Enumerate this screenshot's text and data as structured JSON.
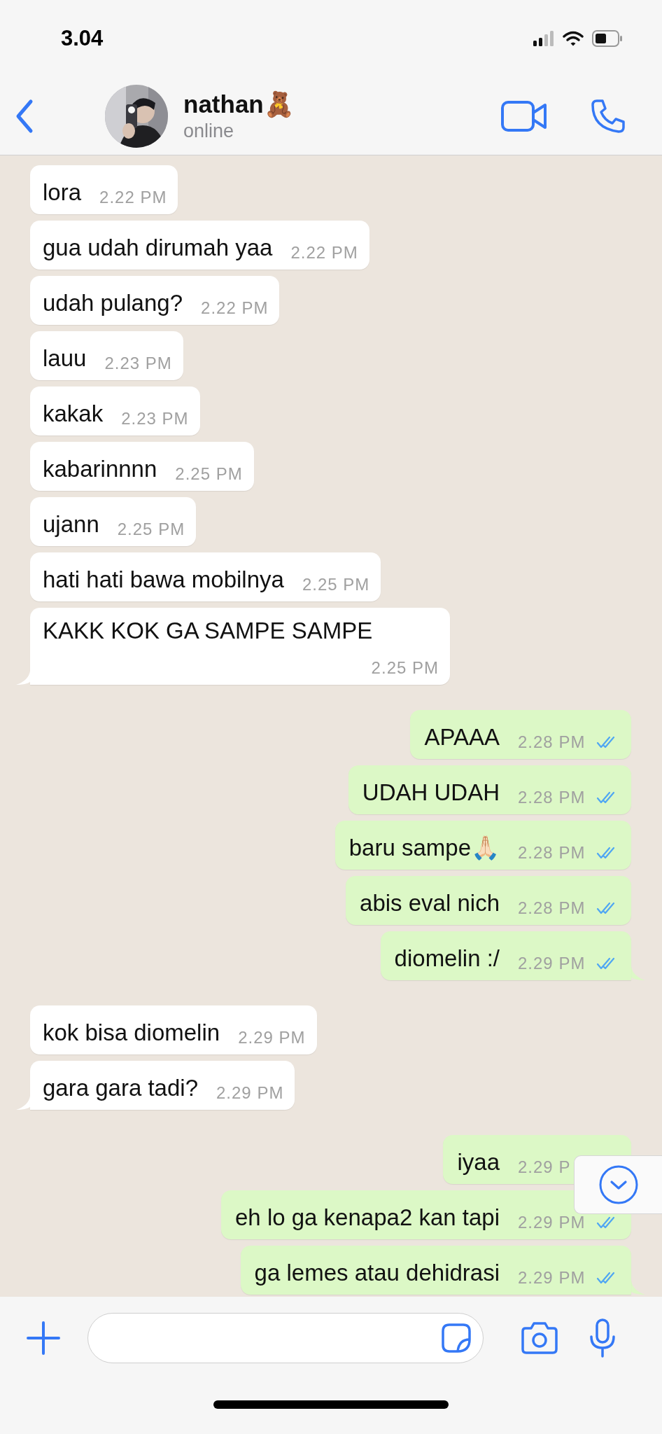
{
  "status_bar": {
    "time": "3.04"
  },
  "header": {
    "name": "nathan🧸",
    "status": "online"
  },
  "messages": [
    {
      "kind": "incoming",
      "text": "lora",
      "time": "2.22 PM",
      "tail": false
    },
    {
      "kind": "incoming",
      "text": "gua udah dirumah yaa",
      "time": "2.22 PM",
      "tail": false
    },
    {
      "kind": "incoming",
      "text": "udah pulang?",
      "time": "2.22 PM",
      "tail": false
    },
    {
      "kind": "incoming",
      "text": "lauu",
      "time": "2.23 PM",
      "tail": false
    },
    {
      "kind": "incoming",
      "text": "kakak",
      "time": "2.23 PM",
      "tail": false
    },
    {
      "kind": "incoming",
      "text": "kabarinnnn",
      "time": "2.25 PM",
      "tail": false
    },
    {
      "kind": "incoming",
      "text": "ujann",
      "time": "2.25 PM",
      "tail": false
    },
    {
      "kind": "incoming",
      "text": "hati hati bawa mobilnya",
      "time": "2.25 PM",
      "tail": false
    },
    {
      "kind": "incoming",
      "text": "KAKK KOK GA SAMPE SAMPE",
      "time": "2.25 PM",
      "tail": true
    },
    {
      "kind": "outgoing",
      "text": "APAAA",
      "time": "2.28 PM",
      "read": true,
      "tail": false
    },
    {
      "kind": "outgoing",
      "text": "UDAH UDAH",
      "time": "2.28 PM",
      "read": true,
      "tail": false
    },
    {
      "kind": "outgoing",
      "text": "baru sampe🙏🏻",
      "time": "2.28 PM",
      "read": true,
      "tail": false
    },
    {
      "kind": "outgoing",
      "text": "abis eval nich",
      "time": "2.28 PM",
      "read": true,
      "tail": false
    },
    {
      "kind": "outgoing",
      "text": "diomelin :/",
      "time": "2.29 PM",
      "read": true,
      "tail": true
    },
    {
      "kind": "incoming",
      "text": "kok bisa diomelin",
      "time": "2.29 PM",
      "tail": false
    },
    {
      "kind": "incoming",
      "text": "gara gara tadi?",
      "time": "2.29 PM",
      "tail": true
    },
    {
      "kind": "outgoing",
      "text": "iyaa",
      "time": "2.29 P",
      "tail": false
    },
    {
      "kind": "outgoing",
      "text": "eh lo ga kenapa2 kan tapi",
      "time": "2.29 PM",
      "read": true,
      "tail": false
    },
    {
      "kind": "outgoing",
      "text": "ga lemes atau dehidrasi",
      "time": "2.29 PM",
      "read": true,
      "tail": true
    }
  ]
}
